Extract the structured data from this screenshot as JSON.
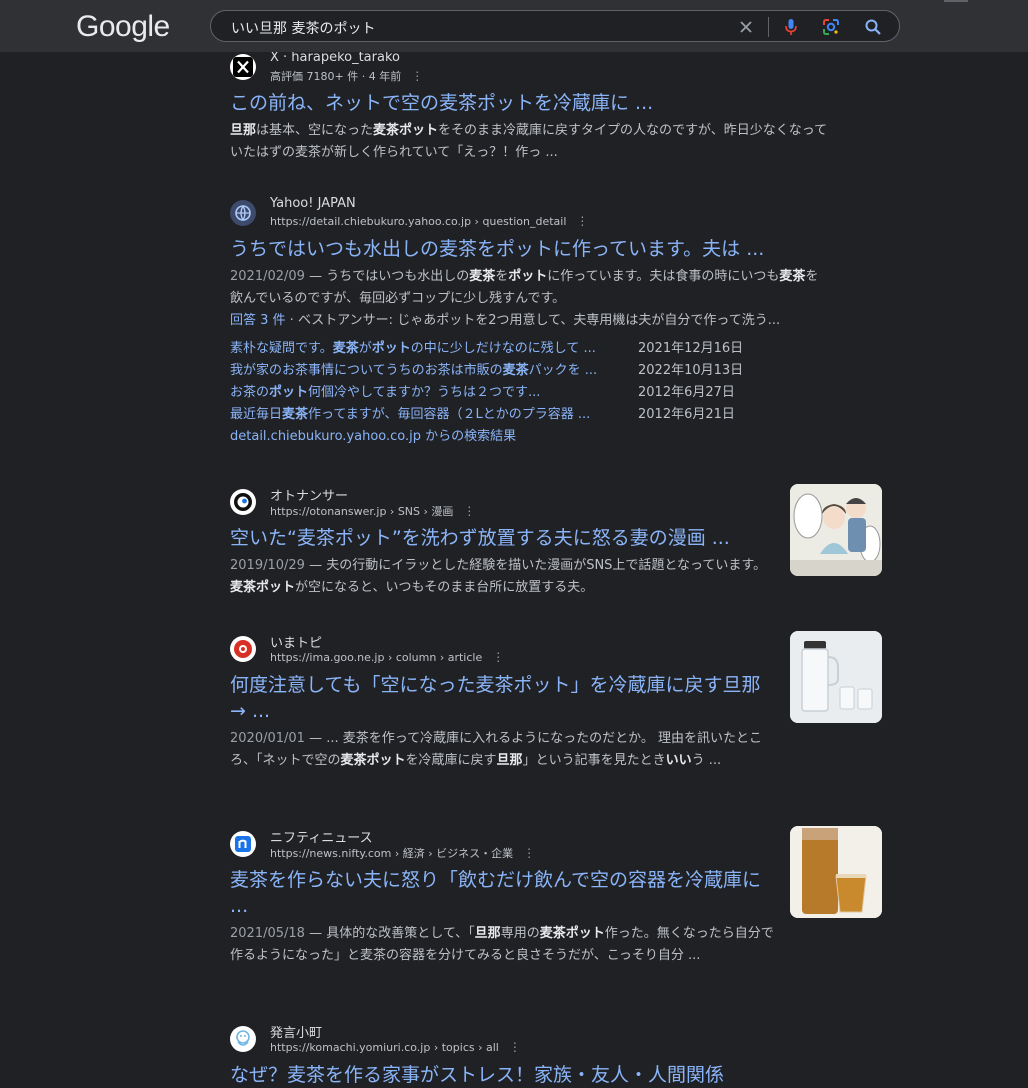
{
  "header": {
    "logo": "Google",
    "query": "いい旦那 麦茶のポット"
  },
  "results": [
    {
      "site_name": "X · harapeko_tarako",
      "meta": "高評価 7180+ 件 · 4 年前",
      "title": "この前ね、ネットで空の麦茶ポットを冷蔵庫に ...",
      "snippet_html": "<b>旦那</b>は基本、空になった<b>麦茶ポット</b>をそのまま冷蔵庫に戻すタイプの人なのですが、昨日少なくなっていたはずの麦茶が新しく作られていて「えっ？！作っ ..."
    },
    {
      "site_name": "Yahoo! JAPAN",
      "url": "https://detail.chiebukuro.yahoo.co.jp › question_detail",
      "title": "うちではいつも水出しの麦茶をポットに作っています。夫は ...",
      "date": "2021/02/09",
      "snippet_html": "うちではいつも水出しの<b>麦茶</b>を<b>ポット</b>に作っています。夫は食事の時にいつも<b>麦茶</b>を飲んでいるのですが、毎回必ずコップに少し残すんです。",
      "answers_label": "回答 3 件",
      "answers_text": " · ベストアンサー: じゃあポットを2つ用意して、夫専用機は夫が自分で作って洗う...",
      "sub_results": [
        {
          "text_html": "素朴な疑問です。<b>麦茶</b>が<b>ポット</b>の中に少しだけなのに残して ...",
          "date": "2021年12月16日"
        },
        {
          "text_html": "我が家のお茶事情についてうちのお茶は市販の<b>麦茶</b>パックを ...",
          "date": "2022年10月13日"
        },
        {
          "text_html": "お茶の<b>ポット</b>何個冷やしてますか？うちは２つです...",
          "date": "2012年6月27日"
        },
        {
          "text_html": "最近毎日<b>麦茶</b>作ってますが、毎回容器（２Lとかのプラ容器 ...",
          "date": "2012年6月21日"
        }
      ],
      "more": "detail.chiebukuro.yahoo.co.jp からの検索結果"
    },
    {
      "site_name": "オトナンサー",
      "url": "https://otonanswer.jp › SNS › 漫画",
      "title": "空いた“麦茶ポット”を洗わず放置する夫に怒る妻の漫画 ...",
      "date": "2019/10/29",
      "snippet_html": "夫の行動にイラッとした経験を描いた漫画がSNS上で話題となっています。<b>麦茶ポット</b>が空になると、いつもそのまま台所に放置する夫。"
    },
    {
      "site_name": "いまトピ",
      "url": "https://ima.goo.ne.jp › column › article",
      "title": "何度注意しても「空になった麦茶ポット」を冷蔵庫に戻す旦那→ ...",
      "date": "2020/01/01",
      "snippet_html": "... 麦茶を作って冷蔵庫に入れるようになったのだとか。 理由を訊いたところ、「ネットで空の<b>麦茶ポット</b>を冷蔵庫に戻す<b>旦那</b>」という記事を見たとき<b>いい</b>う ..."
    },
    {
      "site_name": "ニフティニュース",
      "url": "https://news.nifty.com › 経済 › ビジネス・企業",
      "title": "麦茶を作らない夫に怒り「飲むだけ飲んで空の容器を冷蔵庫に ...",
      "date": "2021/05/18",
      "snippet_html": "具体的な改善策として、「<b>旦那</b>専用の<b>麦茶ポット</b>作った。無くなったら自分で作るようになった」と麦茶の容器を分けてみると良さそうだが、こっそり自分 ..."
    },
    {
      "site_name": "発言小町",
      "url": "https://komachi.yomiuri.co.jp › topics › all",
      "title": "なぜ？麦茶を作る家事がストレス！家族・友人・人間関係"
    }
  ],
  "colors": {
    "background": "#202124",
    "link": "#8ab4f8",
    "text": "#bdc1c6"
  }
}
